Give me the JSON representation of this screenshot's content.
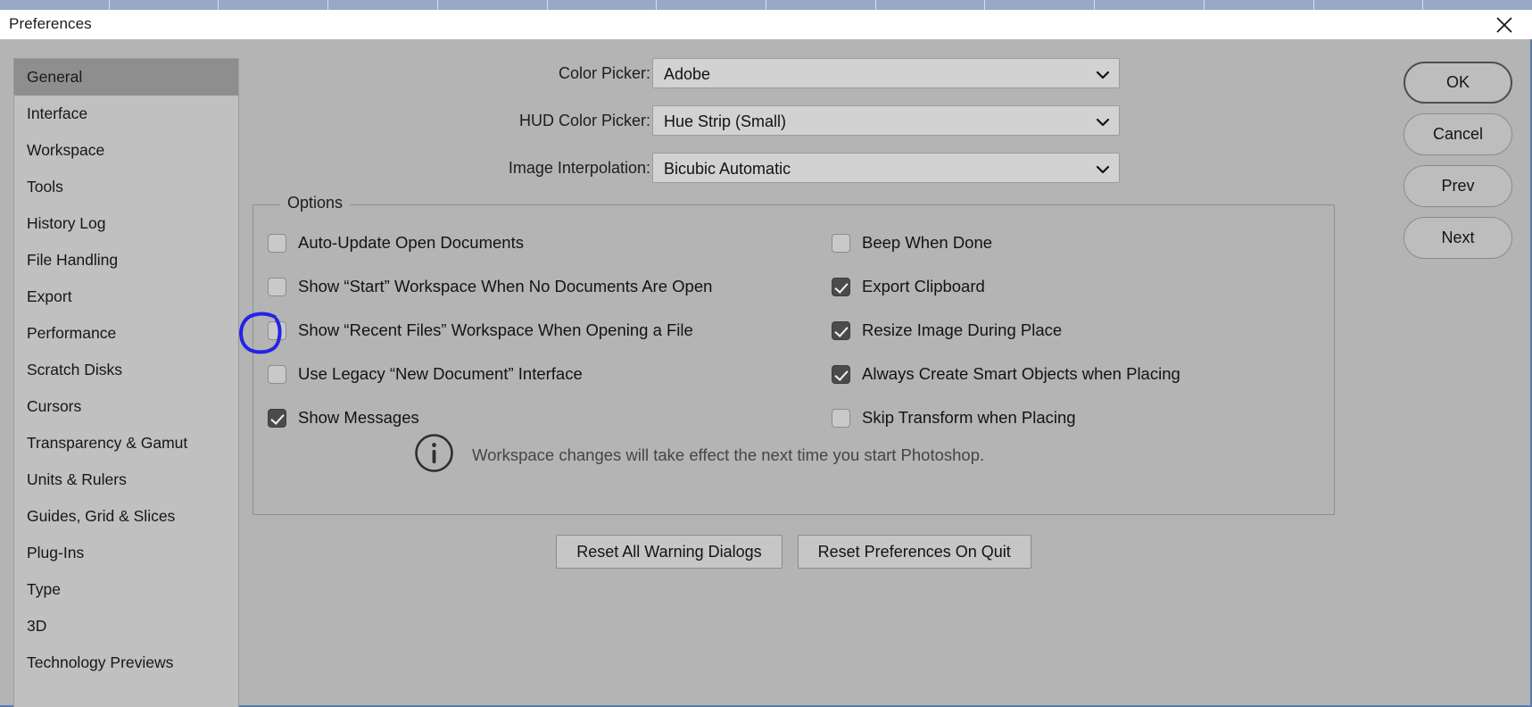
{
  "window": {
    "title": "Preferences",
    "close_icon": "close-icon"
  },
  "sidebar": {
    "items": [
      {
        "label": "General",
        "selected": true
      },
      {
        "label": "Interface",
        "selected": false
      },
      {
        "label": "Workspace",
        "selected": false
      },
      {
        "label": "Tools",
        "selected": false
      },
      {
        "label": "History Log",
        "selected": false
      },
      {
        "label": "File Handling",
        "selected": false
      },
      {
        "label": "Export",
        "selected": false
      },
      {
        "label": "Performance",
        "selected": false
      },
      {
        "label": "Scratch Disks",
        "selected": false
      },
      {
        "label": "Cursors",
        "selected": false
      },
      {
        "label": "Transparency & Gamut",
        "selected": false
      },
      {
        "label": "Units & Rulers",
        "selected": false
      },
      {
        "label": "Guides, Grid & Slices",
        "selected": false
      },
      {
        "label": "Plug-Ins",
        "selected": false
      },
      {
        "label": "Type",
        "selected": false
      },
      {
        "label": "3D",
        "selected": false
      },
      {
        "label": "Technology Previews",
        "selected": false
      }
    ]
  },
  "action_buttons": [
    {
      "label": "OK",
      "primary": true
    },
    {
      "label": "Cancel",
      "primary": false
    },
    {
      "label": "Prev",
      "primary": false
    },
    {
      "label": "Next",
      "primary": false
    }
  ],
  "selects": [
    {
      "label": "Color Picker:",
      "value": "Adobe",
      "icon": "chevron-down-icon"
    },
    {
      "label": "HUD Color Picker:",
      "value": "Hue Strip (Small)",
      "icon": "chevron-down-icon"
    },
    {
      "label": "Image Interpolation:",
      "value": "Bicubic Automatic",
      "icon": "chevron-down-icon"
    }
  ],
  "options": {
    "legend": "Options",
    "left_column": [
      {
        "label": "Auto-Update Open Documents",
        "checked": false
      },
      {
        "label": "Show “Start” Workspace When No Documents Are Open",
        "checked": false
      },
      {
        "label": "Show “Recent Files” Workspace When Opening a File",
        "checked": false
      },
      {
        "label": "Use Legacy “New Document” Interface",
        "checked": false
      },
      {
        "label": "Show Messages",
        "checked": true
      }
    ],
    "right_column": [
      {
        "label": "Beep When Done",
        "checked": false
      },
      {
        "label": "Export Clipboard",
        "checked": true
      },
      {
        "label": "Resize Image During Place",
        "checked": true
      },
      {
        "label": "Always Create Smart Objects when Placing",
        "checked": true
      },
      {
        "label": "Skip Transform when Placing",
        "checked": false
      }
    ],
    "info": {
      "icon": "info-circle-icon",
      "text": "Workspace changes will take effect the next time you start Photoshop."
    }
  },
  "reset_buttons": [
    {
      "label": "Reset All Warning Dialogs"
    },
    {
      "label": "Reset Preferences On Quit"
    }
  ],
  "annotation": {
    "shape": "hand-drawn-circle",
    "color": "#2323e6",
    "targets": "show-start-workspace-checkbox"
  },
  "colors": {
    "dialog_background": "#b4b4b4",
    "sidebar_background": "#c0c0c0",
    "sidebar_selected": "#8e8e8e",
    "titlebar_background": "#ffffff",
    "select_background": "#d2d2d2",
    "checkbox_checked": "#4b4b4b",
    "annotation_blue": "#2323e6"
  }
}
